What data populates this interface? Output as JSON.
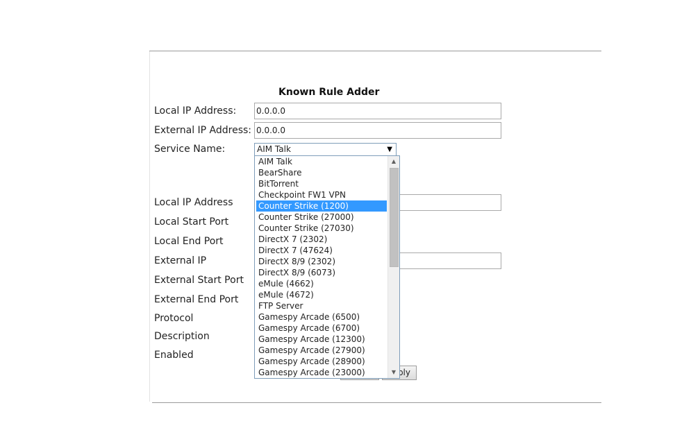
{
  "form": {
    "title": "Known Rule Adder",
    "local_ip_label": "Local IP Address:",
    "local_ip_value": "0.0.0.0",
    "external_ip_label": "External IP Address:",
    "external_ip_value": "0.0.0.0",
    "service_name_label": "Service Name:",
    "service_selected": "AIM Talk"
  },
  "rule_fields": {
    "local_ip_address": "Local IP Address",
    "local_start_port": "Local Start Port",
    "local_end_port": "Local End Port",
    "external_ip": "External IP",
    "external_start_port": "External Start Port",
    "external_end_port": "External End Port",
    "protocol": "Protocol",
    "description": "Description",
    "enabled": "Enabled"
  },
  "buttons": {
    "apply_partial": "ply"
  },
  "dropdown": {
    "highlighted_index": 4,
    "options": [
      "AIM Talk",
      "BearShare",
      "BitTorrent",
      "Checkpoint FW1 VPN",
      "Counter Strike (1200)",
      "Counter Strike (27000)",
      "Counter Strike (27030)",
      "DirectX 7 (2302)",
      "DirectX 7 (47624)",
      "DirectX 8/9 (2302)",
      "DirectX 8/9 (6073)",
      "eMule (4662)",
      "eMule (4672)",
      "FTP Server",
      "Gamespy Arcade (6500)",
      "Gamespy Arcade (6700)",
      "Gamespy Arcade (12300)",
      "Gamespy Arcade (27900)",
      "Gamespy Arcade (28900)",
      "Gamespy Arcade (23000)"
    ]
  },
  "icons": {
    "select_arrow": "caret-down-icon",
    "scroll_up": "scroll-up-arrow-icon",
    "scroll_down": "scroll-down-arrow-icon"
  }
}
